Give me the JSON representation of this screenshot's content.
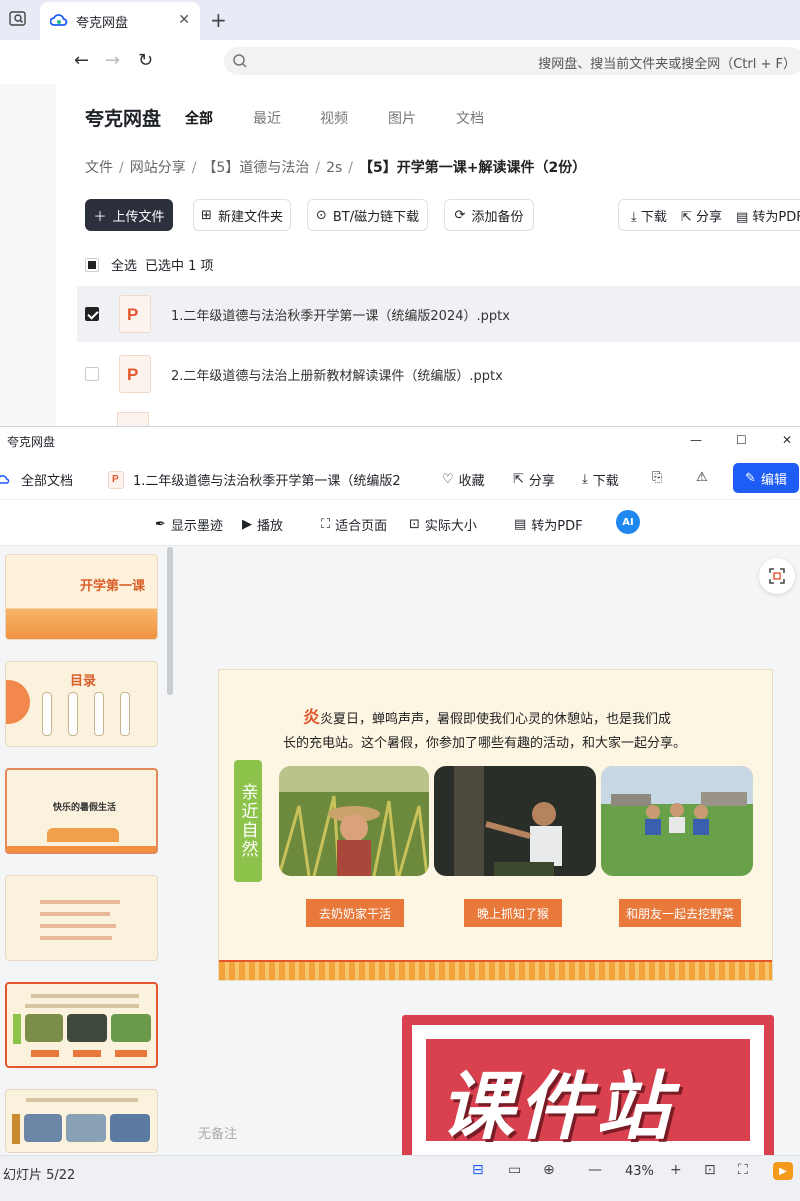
{
  "browser": {
    "tab_title": "夸克网盘",
    "search_placeholder": "搜网盘、搜当前文件夹或搜全网（Ctrl + F）"
  },
  "drive": {
    "brand": "夸克网盘",
    "tabs": [
      {
        "label": "全部",
        "active": true
      },
      {
        "label": "最近"
      },
      {
        "label": "视频"
      },
      {
        "label": "图片"
      },
      {
        "label": "文档"
      }
    ],
    "breadcrumb": [
      "文件",
      "网站分享",
      "【5】道德与法治",
      "2s",
      "【5】开学第一课+解读课件（2份）"
    ],
    "toolbar": {
      "upload": "上传文件",
      "new_folder": "新建文件夹",
      "bt": "BT/磁力链下载",
      "backup": "添加备份",
      "download": "下载",
      "share": "分享",
      "convert": "转为PDF"
    },
    "selection": {
      "select_all": "全选",
      "selected_text": "已选中 1 项"
    },
    "files": [
      {
        "name": "1.二年级道德与法治秋季开学第一课（统编版2024）.pptx",
        "selected": true
      },
      {
        "name": "2.二年级道德与法治上册新教材解读课件（统编版）.pptx",
        "selected": false
      }
    ]
  },
  "preview": {
    "window_title": "夸克网盘",
    "all_docs": "全部文档",
    "doc_title": "1.二年级道德与法治秋季开学第一课（统编版2",
    "favorite": "收藏",
    "share": "分享",
    "download": "下载",
    "edit": "编辑",
    "tools": {
      "ink": "显示墨迹",
      "play": "播放",
      "fit": "适合页面",
      "actual": "实际大小",
      "to_pdf": "转为PDF"
    },
    "thumbnails": [
      {
        "title": "开学第一课"
      },
      {
        "title": "目录"
      },
      {
        "title": "快乐的暑假生活"
      },
      {
        "title": ""
      },
      {
        "title": "",
        "selected": true
      },
      {
        "title": ""
      }
    ],
    "slide": {
      "first_char": "炎",
      "line1_rest": "炎夏日，蝉鸣声声，暑假即使我们心灵的休憩站，也是我们成",
      "line2": "长的充电站。这个暑假，你参加了哪些有趣的活动，和大家一起分享。",
      "tag": "亲近自然",
      "captions": [
        "去奶奶家干活",
        "晚上抓知了猴",
        "和朋友一起去挖野菜"
      ]
    },
    "watermark": "课件站",
    "notes": "无备注",
    "status": {
      "slide_counter": "幻灯片 5/22",
      "zoom": "43%"
    }
  },
  "colors": {
    "accent": "#1d5cf5",
    "ppt": "#e4572e",
    "watermark": "#d9414f",
    "green_tag": "#8dc34a",
    "caption": "#e8793a"
  }
}
